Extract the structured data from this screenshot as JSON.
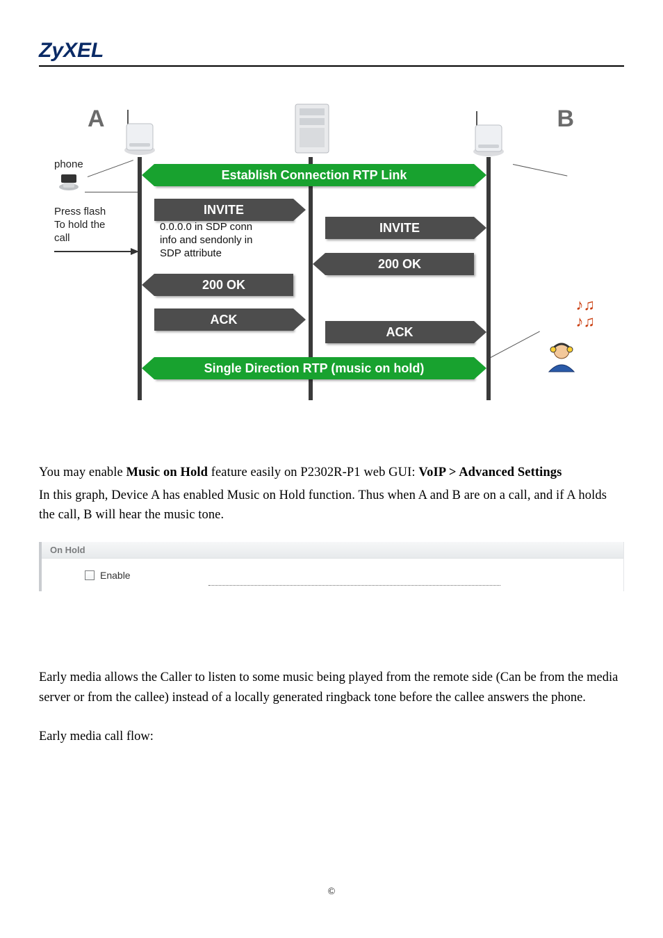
{
  "brand": "ZyXEL",
  "diagram": {
    "labels": {
      "A": "A",
      "B": "B"
    },
    "phone": {
      "title": "phone"
    },
    "flash": {
      "line1": "Press flash",
      "line2": "To hold the",
      "line3": "call"
    },
    "sdp": {
      "line1": "0.0.0.0 in SDP conn",
      "line2": "info and sendonly in",
      "line3": "SDP attribute"
    },
    "messages": {
      "establish": "Establish Connection RTP Link",
      "invite_a": "INVITE",
      "invite_b": "INVITE",
      "ok_a": "200 OK",
      "ok_b": "200 OK",
      "ack_a": "ACK",
      "ack_b": "ACK",
      "single_dir": "Single Direction RTP (music on hold)"
    }
  },
  "body": {
    "p1_pre": "You may enable ",
    "p1_bold1": "Music on Hold",
    "p1_mid": " feature easily on P2302R-P1 web GUI: ",
    "p1_bold2": "VoIP > Advanced Settings",
    "p2": "In this graph, Device A has enabled Music on Hold function. Thus when A and B are on a call, and if A holds the call, B will hear the music tone."
  },
  "panel": {
    "title": "On Hold",
    "enable": "Enable"
  },
  "early_media": {
    "p1": "Early media allows the Caller to listen to some music being played from the remote side (Can be from the media server or from the callee) instead of a locally generated ringback tone before the callee answers the phone.",
    "p2": "Early media call flow:"
  },
  "footer": "©"
}
